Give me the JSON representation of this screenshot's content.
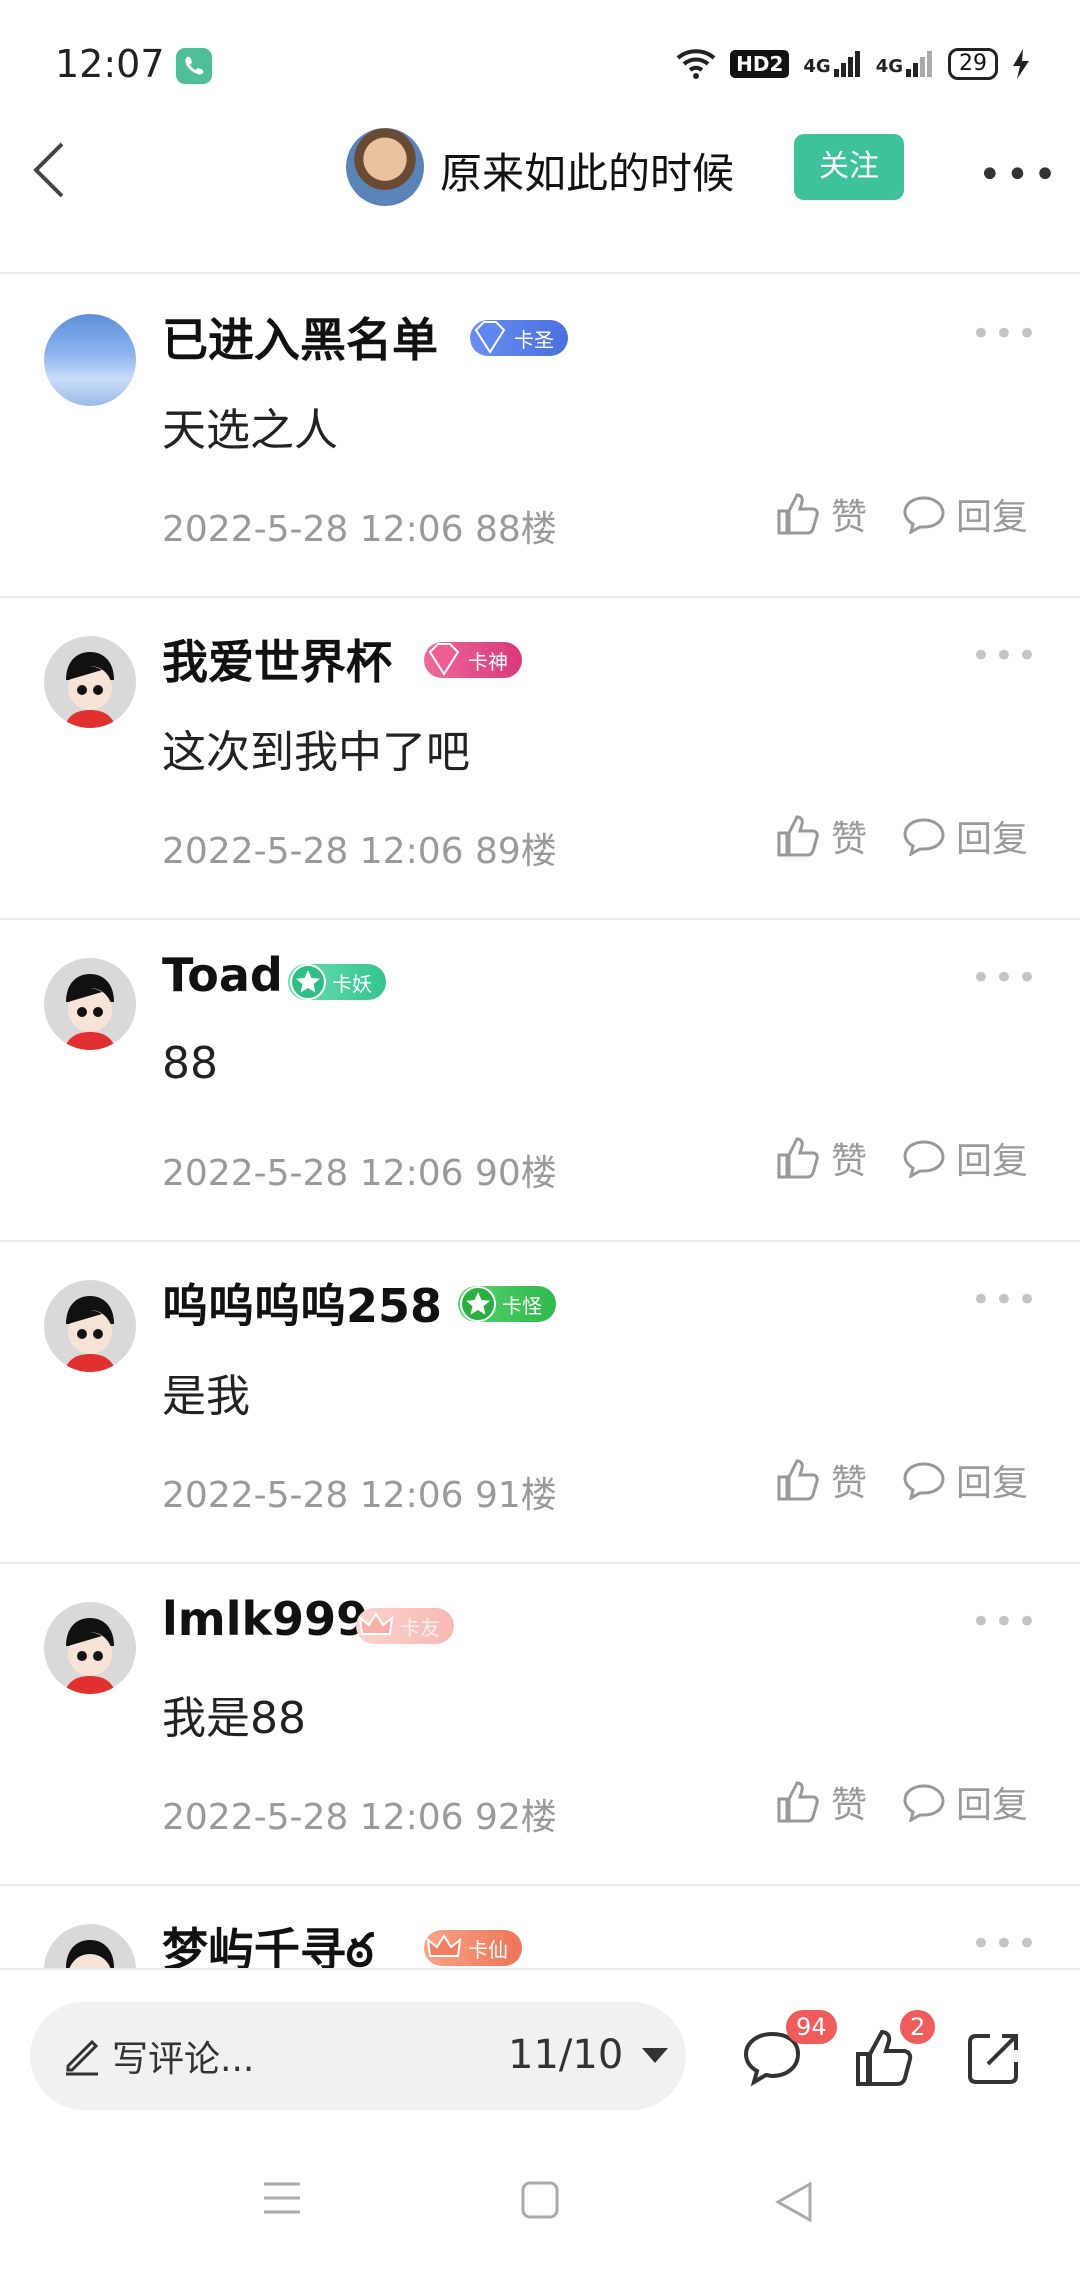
{
  "status_bar": {
    "time": "12:07",
    "hd": "HD2",
    "net1": "4G",
    "net2": "4G",
    "battery": "29"
  },
  "header": {
    "title": "原来如此的时候",
    "follow_label": "关注"
  },
  "comments": [
    {
      "username": "已进入黑名单",
      "badge": "卡圣",
      "text": "天选之人",
      "meta": "2022-5-28 12:06  88楼",
      "like": "赞",
      "reply": "回复"
    },
    {
      "username": "我爱世界杯",
      "badge": "卡神",
      "text": "这次到我中了吧",
      "meta": "2022-5-28 12:06  89楼",
      "like": "赞",
      "reply": "回复"
    },
    {
      "username": "Toad",
      "badge": "卡妖",
      "text": "88",
      "meta": "2022-5-28 12:06  90楼",
      "like": "赞",
      "reply": "回复"
    },
    {
      "username": "呜呜呜呜258",
      "badge": "卡怪",
      "text": "是我",
      "meta": "2022-5-28 12:06  91楼",
      "like": "赞",
      "reply": "回复"
    },
    {
      "username": "lmlk999",
      "badge": "卡友",
      "text": "我是88",
      "meta": "2022-5-28 12:06  92楼",
      "like": "赞",
      "reply": "回复"
    },
    {
      "username": "梦屿千寻ఠ",
      "badge": "卡仙"
    }
  ],
  "bottom_bar": {
    "write_placeholder": "写评论...",
    "page_indicator": "11/10",
    "comment_count": "94",
    "like_count": "2"
  },
  "colors": {
    "accent": "#3ec29b",
    "badge_red": "#f05b5b"
  }
}
